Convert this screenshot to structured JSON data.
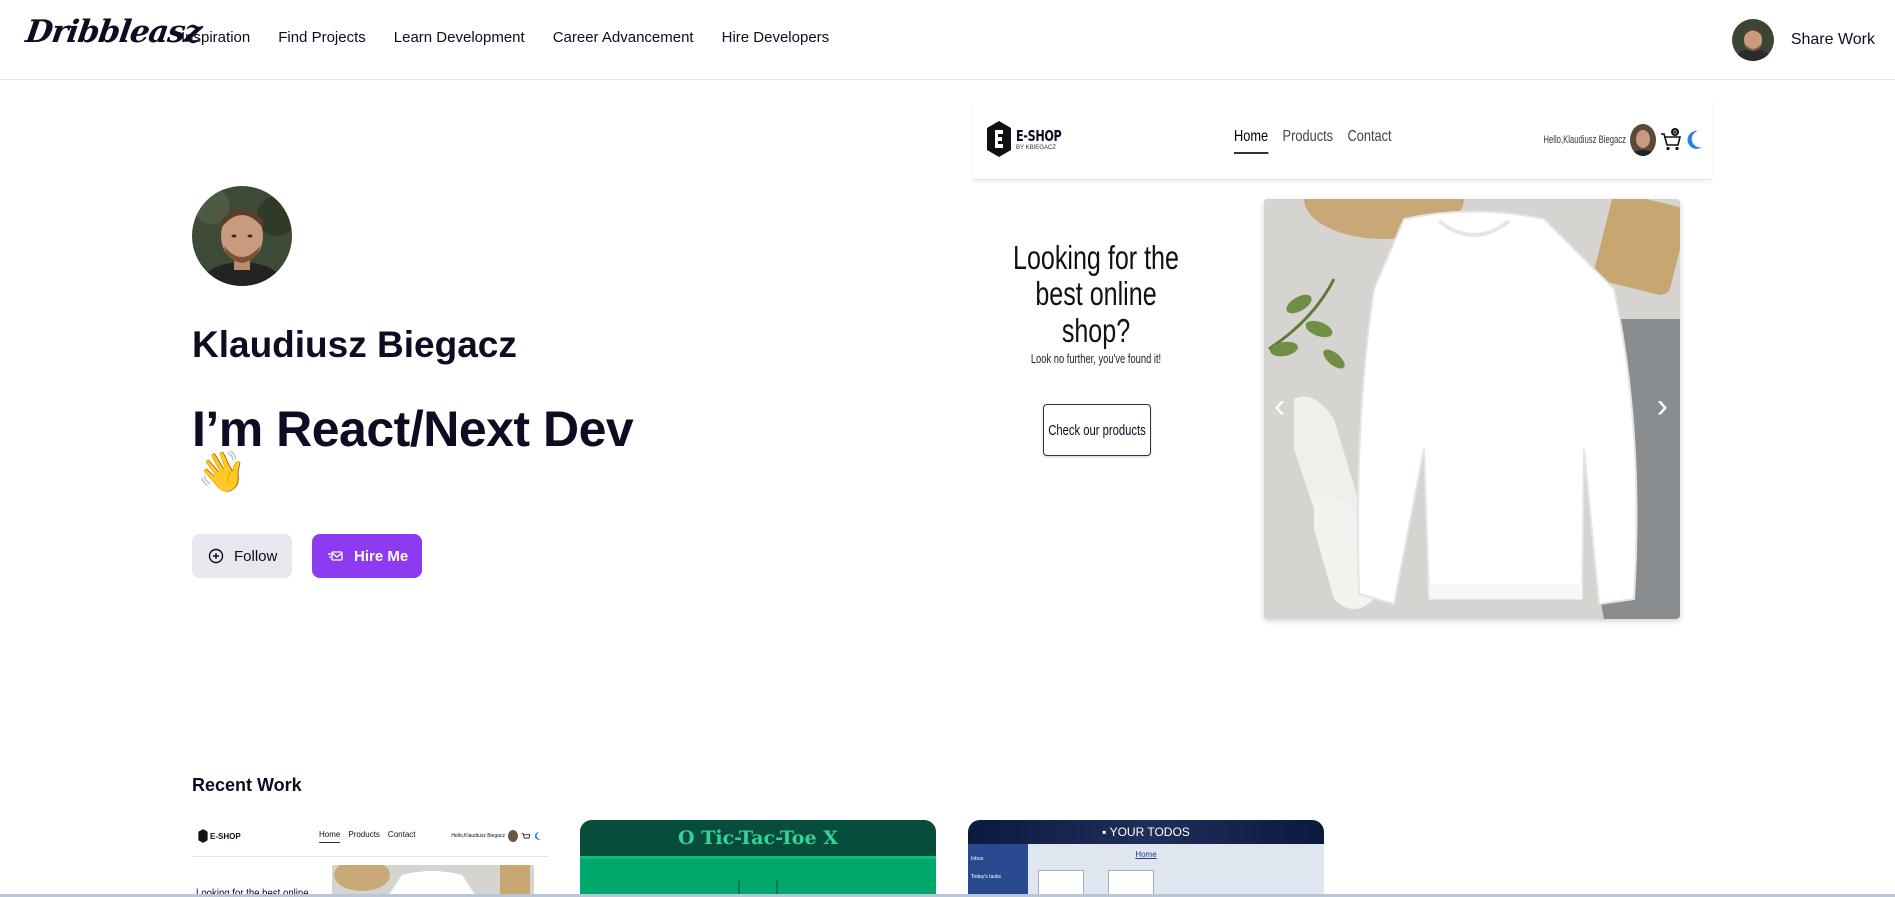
{
  "brand": {
    "logo": "Dribbleasz"
  },
  "nav": {
    "links": [
      "Inspiration",
      "Find Projects",
      "Learn Development",
      "Career Advancement",
      "Hire Developers"
    ],
    "share_work": "Share Work"
  },
  "profile": {
    "name": "Klaudiusz Biegacz",
    "title": "I’m React/Next Dev",
    "wave_emoji": "👋",
    "follow_label": "Follow",
    "hire_label": "Hire Me",
    "accent_color": "#8c3bf0"
  },
  "featured_shot": {
    "logo": "E-SHOP",
    "logo_sub": "BY KBIEGACZ",
    "nav": [
      "Home",
      "Products",
      "Contact"
    ],
    "greeting": "Hello,Klaudiusz Biegacz",
    "cart_count": "0",
    "headline": "Looking for the best online shop?",
    "subheadline": "Look no further, you've found it!",
    "cta": "Check our products",
    "prev": "‹",
    "next": "›"
  },
  "recent_work": {
    "title": "Recent Work",
    "cards": [
      {
        "nav": [
          "Home",
          "Products",
          "Contact"
        ],
        "logo": "E-SHOP",
        "greeting": "Hello,Klaudiusz Biegacz",
        "headline": "Looking for the best online"
      },
      {
        "title": "Tic-Tac-Toe",
        "o": "O",
        "x": "X"
      },
      {
        "title": "YOUR TODOS",
        "nav": "Home",
        "items": [
          "Inbox",
          "Today's tasks"
        ]
      }
    ]
  }
}
